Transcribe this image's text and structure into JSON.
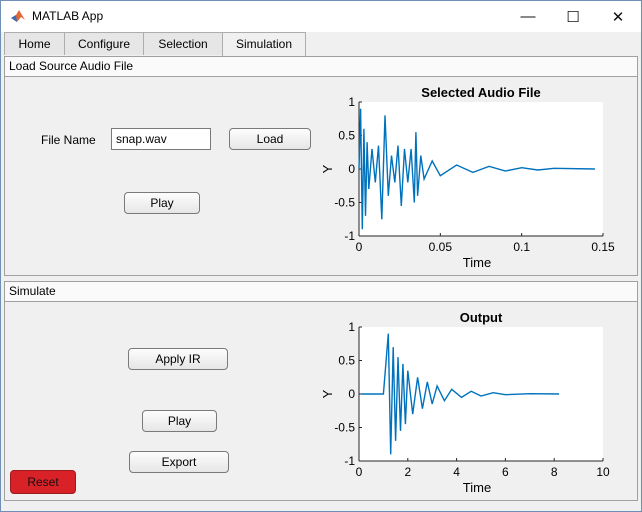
{
  "window": {
    "title": "MATLAB App",
    "minimize_glyph": "—",
    "maximize_glyph": "☐",
    "close_glyph": "✕"
  },
  "tabs": [
    {
      "label": "Home",
      "active": false
    },
    {
      "label": "Configure",
      "active": false
    },
    {
      "label": "Selection",
      "active": false
    },
    {
      "label": "Simulation",
      "active": true
    }
  ],
  "load_panel": {
    "title": "Load Source Audio File",
    "file_name_label": "File Name",
    "file_name_value": "snap.wav",
    "load_label": "Load",
    "play_label": "Play"
  },
  "simulate_panel": {
    "title": "Simulate",
    "apply_ir_label": "Apply IR",
    "play_label": "Play",
    "export_label": "Export",
    "reset_label": "Reset"
  },
  "colors": {
    "signal": "#0072bd",
    "reset": "#d92128"
  },
  "chart_data": [
    {
      "type": "line",
      "title": "Selected Audio File",
      "xlabel": "Time",
      "ylabel": "Y",
      "xlim": [
        0,
        0.15
      ],
      "ylim": [
        -1,
        1
      ],
      "xticks": [
        "0",
        "0.05",
        "0.1",
        "0.15"
      ],
      "yticks": [
        "1",
        "0.5",
        "0",
        "-0.5",
        "-1"
      ],
      "series": [
        {
          "x": [
            0,
            0.001,
            0.002,
            0.003,
            0.004,
            0.005,
            0.006,
            0.008,
            0.01,
            0.012,
            0.014,
            0.016,
            0.018,
            0.02,
            0.022,
            0.024,
            0.026,
            0.028,
            0.03,
            0.032,
            0.034,
            0.035,
            0.036,
            0.038,
            0.04,
            0.045,
            0.05,
            0.06,
            0.07,
            0.08,
            0.09,
            0.1,
            0.11,
            0.12,
            0.145
          ],
          "y": [
            0,
            0.9,
            -0.9,
            0.6,
            -0.7,
            0.4,
            -0.3,
            0.3,
            -0.2,
            0.35,
            -0.75,
            0.8,
            -0.4,
            0.2,
            -0.2,
            0.35,
            -0.55,
            0.3,
            -0.2,
            0.3,
            -0.5,
            0.55,
            -0.4,
            0.2,
            -0.15,
            0.12,
            -0.1,
            0.06,
            -0.05,
            0.04,
            -0.03,
            0.02,
            -0.015,
            0.01,
            0
          ]
        }
      ]
    },
    {
      "type": "line",
      "title": "Output",
      "xlabel": "Time",
      "ylabel": "Y",
      "xlim": [
        0,
        10
      ],
      "ylim": [
        -1,
        1
      ],
      "xticks": [
        "0",
        "2",
        "4",
        "6",
        "8",
        "10"
      ],
      "yticks": [
        "1",
        "0.5",
        "0",
        "-0.5",
        "-1"
      ],
      "series": [
        {
          "x": [
            0.1,
            1.0,
            1.2,
            1.3,
            1.4,
            1.5,
            1.6,
            1.7,
            1.8,
            1.9,
            2.0,
            2.2,
            2.4,
            2.6,
            2.8,
            3.0,
            3.2,
            3.5,
            3.8,
            4.2,
            4.6,
            5.0,
            5.5,
            6.0,
            7.0,
            8.2
          ],
          "y": [
            0,
            0,
            0.9,
            -0.9,
            0.7,
            -0.7,
            0.55,
            -0.55,
            0.45,
            -0.45,
            0.35,
            -0.3,
            0.25,
            -0.22,
            0.18,
            -0.15,
            0.12,
            -0.1,
            0.07,
            -0.05,
            0.04,
            -0.03,
            0.02,
            -0.01,
            0.005,
            0
          ]
        }
      ]
    }
  ]
}
